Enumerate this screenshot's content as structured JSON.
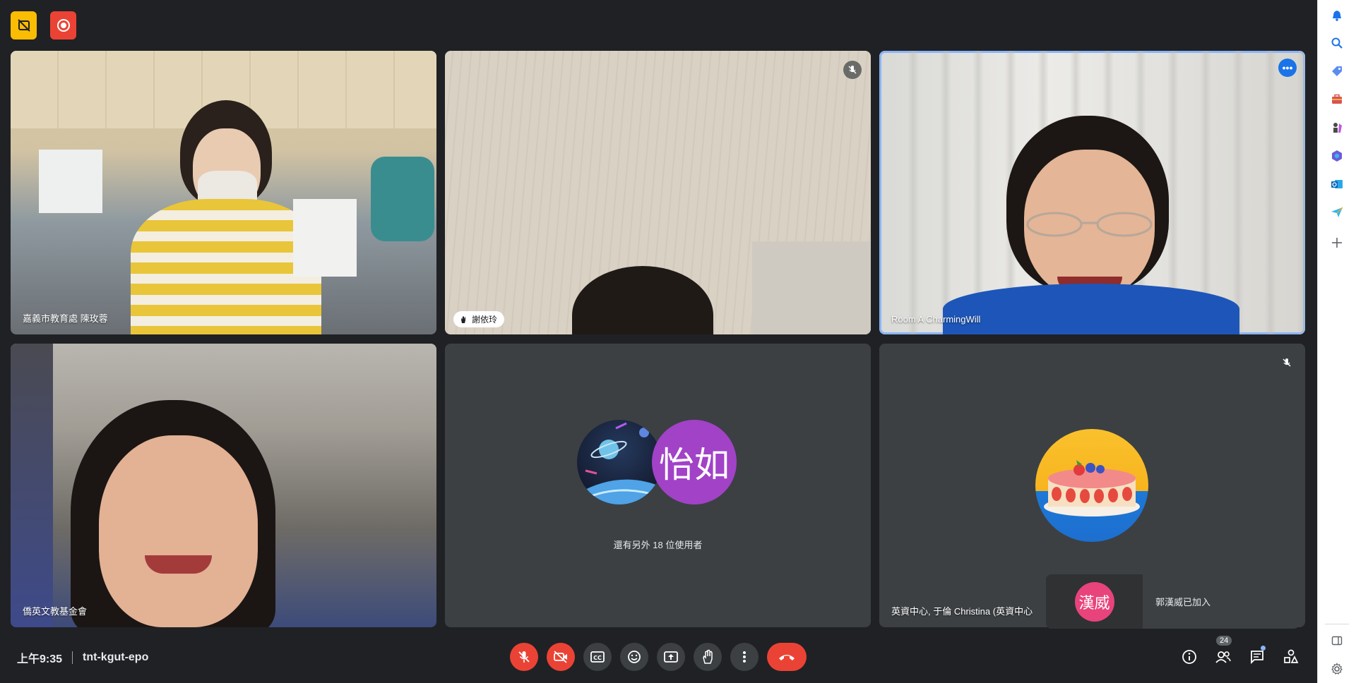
{
  "meeting": {
    "time": "上午9:35",
    "code": "tnt-kgut-epo"
  },
  "tiles": [
    {
      "name": "嘉義市教育處 陳玫蓉"
    },
    {
      "name": "謝依玲"
    },
    {
      "name": "Room A CharmingWill"
    },
    {
      "name": "僑英文教基金會"
    },
    {
      "avatar_text": "怡如",
      "others_text": "還有另外 18 位使用者"
    },
    {
      "name": "英資中心, 于倫 Christina (英資中心"
    }
  ],
  "toast": {
    "avatar_text": "漢威",
    "message": "郭漢威已加入"
  },
  "participants_count": "24",
  "colors": {
    "background": "#202124",
    "tile": "#3c4043",
    "danger": "#ea4335",
    "active_border": "#8ab4f8",
    "avatar_purple": "#a142c7",
    "avatar_pink": "#e8437b"
  }
}
